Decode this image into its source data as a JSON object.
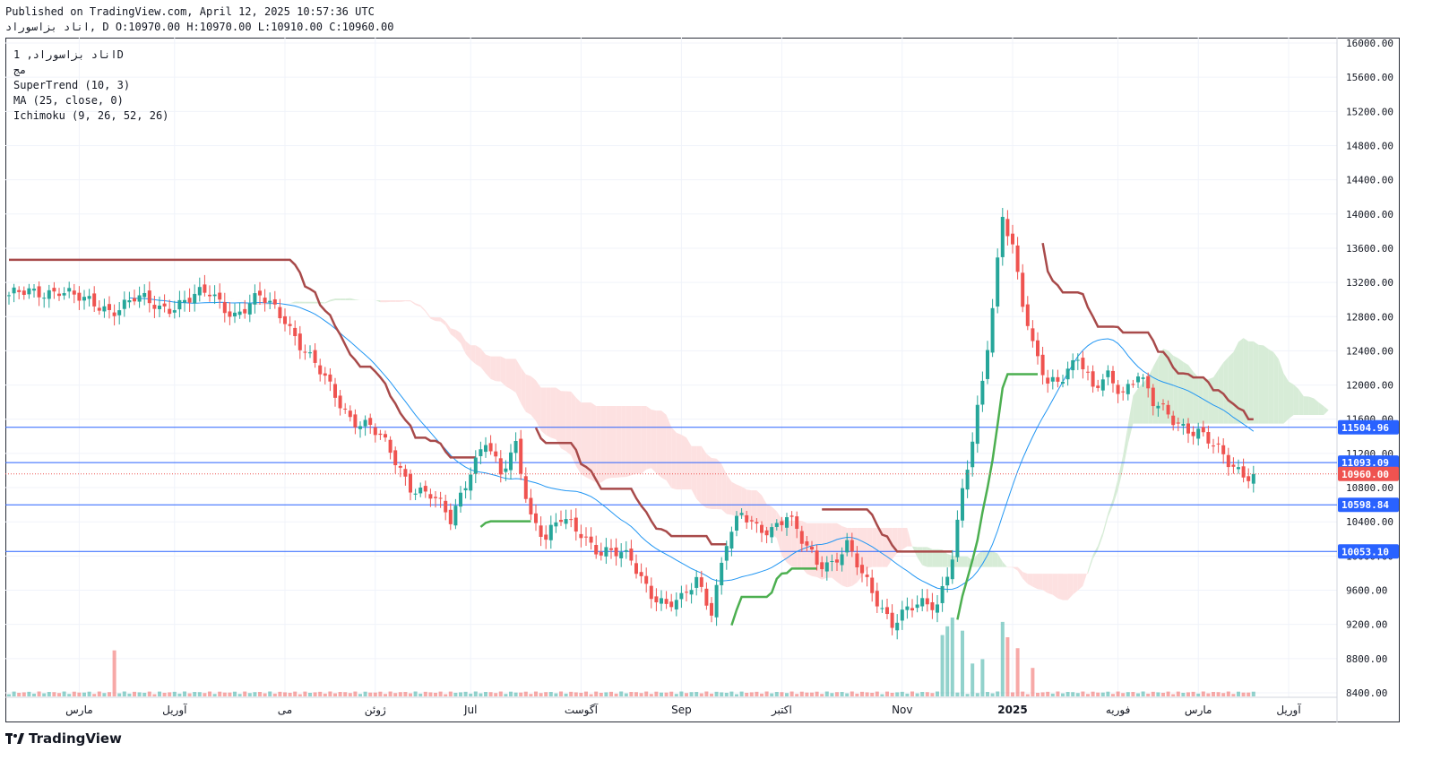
{
  "header": {
    "published": "Published on TradingView.com, April 12, 2025 10:57:36 UTC",
    "ohlc_line": "اناد بزاسوراد, D O:10970.00 H:10970.00 L:10910.00 C:10960.00"
  },
  "legend": {
    "symbol": "اناد بزاسوراد, 1D",
    "exchange": "مج",
    "ind1": "SuperTrend (10, 3)",
    "ind2": "MA (25, close, 0)",
    "ind3": "Ichimoku (9, 26, 52, 26)"
  },
  "footer": {
    "brand": "TradingView",
    "logo_icon": "tradingview-logo-icon"
  },
  "colors": {
    "up": "#26a69a",
    "down": "#ef5350",
    "ma": "#2196f3",
    "st_up": "#4caf50",
    "st_down": "#a84a4a",
    "cloud_bull": "#d7ecd7",
    "cloud_bear": "#fde1e1",
    "hline": "#2962ff",
    "last_price": "#ef5350"
  },
  "chart_data": {
    "type": "candlestick",
    "y_axis_ticks": [
      16000,
      15600,
      15200,
      14800,
      14400,
      14000,
      13600,
      13200,
      12800,
      12400,
      12000,
      11600,
      11200,
      10800,
      10400,
      10000,
      9600,
      9200,
      8800,
      8400
    ],
    "y_tick_labels": [
      "16000.00",
      "15600.00",
      "15200.00",
      "14800.00",
      "14400.00",
      "14000.00",
      "13600.00",
      "13200.00",
      "12800.00",
      "12400.00",
      "12000.00",
      "11600.00",
      "11200.00",
      "10800.00",
      "10400.00",
      "10000.00",
      "9600.00",
      "9200.00",
      "8800.00",
      "8400.00"
    ],
    "ylim": [
      8400,
      16000
    ],
    "x_labels": [
      {
        "label": "مارس",
        "bar": 14
      },
      {
        "label": "آوریل",
        "bar": 33
      },
      {
        "label": "می",
        "bar": 55
      },
      {
        "label": "ژوئن",
        "bar": 73
      },
      {
        "label": "Jul",
        "bar": 92
      },
      {
        "label": "آگوست",
        "bar": 114
      },
      {
        "label": "Sep",
        "bar": 134
      },
      {
        "label": "اکتبر",
        "bar": 154
      },
      {
        "label": "Nov",
        "bar": 178
      },
      {
        "label": "2025",
        "bar": 200
      },
      {
        "label": "فوریه",
        "bar": 221
      },
      {
        "label": "مارس",
        "bar": 237
      },
      {
        "label": "آوریل",
        "bar": 255
      }
    ],
    "horizontal_levels": [
      {
        "value": 11504.96,
        "label": "11504.96"
      },
      {
        "value": 11093.09,
        "label": "11093.09"
      },
      {
        "value": 10598.84,
        "label": "10598.84"
      },
      {
        "value": 10053.1,
        "label": "10053.10"
      }
    ],
    "last_price": {
      "value": 10960.0,
      "label": "10960.00"
    },
    "close_anchors": [
      [
        0,
        13050
      ],
      [
        5,
        13050
      ],
      [
        10,
        13150
      ],
      [
        15,
        12950
      ],
      [
        20,
        12900
      ],
      [
        25,
        13000
      ],
      [
        30,
        12900
      ],
      [
        35,
        13000
      ],
      [
        40,
        13050
      ],
      [
        45,
        12850
      ],
      [
        50,
        13000
      ],
      [
        55,
        12800
      ],
      [
        60,
        12300
      ],
      [
        64,
        11950
      ],
      [
        68,
        11650
      ],
      [
        72,
        11500
      ],
      [
        76,
        11200
      ],
      [
        80,
        10850
      ],
      [
        84,
        10700
      ],
      [
        88,
        10400
      ],
      [
        92,
        11050
      ],
      [
        95,
        11350
      ],
      [
        98,
        10900
      ],
      [
        101,
        11300
      ],
      [
        104,
        10500
      ],
      [
        107,
        10200
      ],
      [
        110,
        10400
      ],
      [
        114,
        10300
      ],
      [
        118,
        10050
      ],
      [
        121,
        10000
      ],
      [
        124,
        9950
      ],
      [
        128,
        9600
      ],
      [
        131,
        9400
      ],
      [
        134,
        9450
      ],
      [
        137,
        9750
      ],
      [
        140,
        9400
      ],
      [
        143,
        10150
      ],
      [
        146,
        10450
      ],
      [
        149,
        10350
      ],
      [
        152,
        10350
      ],
      [
        155,
        10450
      ],
      [
        158,
        10150
      ],
      [
        161,
        9950
      ],
      [
        164,
        9950
      ],
      [
        167,
        10100
      ],
      [
        170,
        9750
      ],
      [
        173,
        9500
      ],
      [
        176,
        9250
      ],
      [
        179,
        9350
      ],
      [
        182,
        9400
      ],
      [
        185,
        9450
      ],
      [
        188,
        10050
      ],
      [
        190,
        10750
      ],
      [
        192,
        11300
      ],
      [
        194,
        12000
      ],
      [
        196,
        12900
      ],
      [
        198,
        14050
      ],
      [
        200,
        13650
      ],
      [
        202,
        12950
      ],
      [
        204,
        12400
      ],
      [
        207,
        12000
      ],
      [
        210,
        12150
      ],
      [
        213,
        12350
      ],
      [
        216,
        11900
      ],
      [
        219,
        12100
      ],
      [
        222,
        11950
      ],
      [
        225,
        12150
      ],
      [
        228,
        11750
      ],
      [
        231,
        11650
      ],
      [
        234,
        11550
      ],
      [
        237,
        11450
      ],
      [
        240,
        11250
      ],
      [
        243,
        11100
      ],
      [
        246,
        11000
      ],
      [
        248,
        10960
      ]
    ],
    "volume_spikes": [
      [
        21,
        420
      ],
      [
        186,
        560
      ],
      [
        187,
        640
      ],
      [
        188,
        720
      ],
      [
        190,
        600
      ],
      [
        192,
        300
      ],
      [
        194,
        340
      ],
      [
        198,
        680
      ],
      [
        199,
        540
      ],
      [
        201,
        440
      ],
      [
        204,
        260
      ]
    ],
    "volume_ylim": [
      0,
      900
    ],
    "series": [
      {
        "name": "SuperTrend (10, 3)"
      },
      {
        "name": "MA (25, close, 0)"
      },
      {
        "name": "Ichimoku (9, 26, 52, 26)"
      }
    ]
  }
}
